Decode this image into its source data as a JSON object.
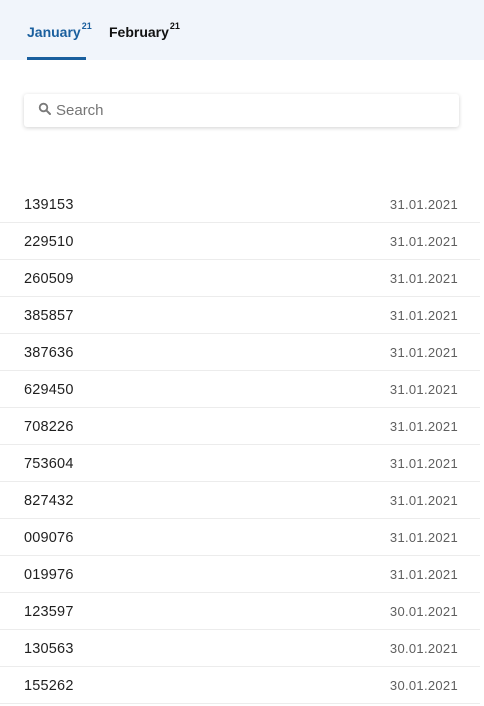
{
  "tabs": [
    {
      "label": "January",
      "count": "21"
    },
    {
      "label": "February",
      "count": "21"
    }
  ],
  "search": {
    "placeholder": "Search",
    "value": ""
  },
  "rows": [
    {
      "number": "139153",
      "date": "31.01.2021"
    },
    {
      "number": "229510",
      "date": "31.01.2021"
    },
    {
      "number": "260509",
      "date": "31.01.2021"
    },
    {
      "number": "385857",
      "date": "31.01.2021"
    },
    {
      "number": "387636",
      "date": "31.01.2021"
    },
    {
      "number": "629450",
      "date": "31.01.2021"
    },
    {
      "number": "708226",
      "date": "31.01.2021"
    },
    {
      "number": "753604",
      "date": "31.01.2021"
    },
    {
      "number": "827432",
      "date": "31.01.2021"
    },
    {
      "number": "009076",
      "date": "31.01.2021"
    },
    {
      "number": "019976",
      "date": "31.01.2021"
    },
    {
      "number": "123597",
      "date": "30.01.2021"
    },
    {
      "number": "130563",
      "date": "30.01.2021"
    },
    {
      "number": "155262",
      "date": "30.01.2021"
    }
  ],
  "colors": {
    "accent": "#1a5f9e",
    "tabbar_bg": "#f1f5fb"
  }
}
